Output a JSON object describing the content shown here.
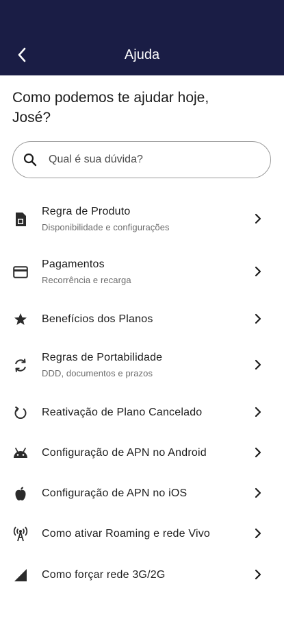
{
  "header": {
    "title": "Ajuda",
    "back_icon": "chevron-left-icon",
    "background": "#1a1d45"
  },
  "greeting": {
    "line1": "Como podemos te ajudar hoje,",
    "line2": "José?"
  },
  "search": {
    "placeholder": "Qual é sua dúvida?",
    "value": "",
    "icon": "search-icon"
  },
  "items": [
    {
      "icon": "sim-card-icon",
      "title": "Regra de Produto",
      "subtitle": "Disponibilidade e configurações"
    },
    {
      "icon": "credit-card-icon",
      "title": "Pagamentos",
      "subtitle": "Recorrência e recarga"
    },
    {
      "icon": "star-icon",
      "title": "Benefícios dos Planos",
      "subtitle": ""
    },
    {
      "icon": "sync-icon",
      "title": "Regras de Portabilidade",
      "subtitle": "DDD, documentos e prazos"
    },
    {
      "icon": "refresh-icon",
      "title": "Reativação de Plano Cancelado",
      "subtitle": ""
    },
    {
      "icon": "android-icon",
      "title": "Configuração de APN no Android",
      "subtitle": ""
    },
    {
      "icon": "apple-icon",
      "title": "Configuração de APN no iOS",
      "subtitle": ""
    },
    {
      "icon": "antenna-icon",
      "title": "Como ativar Roaming e rede Vivo",
      "subtitle": ""
    },
    {
      "icon": "signal-icon",
      "title": "Como forçar rede 3G/2G",
      "subtitle": ""
    }
  ]
}
